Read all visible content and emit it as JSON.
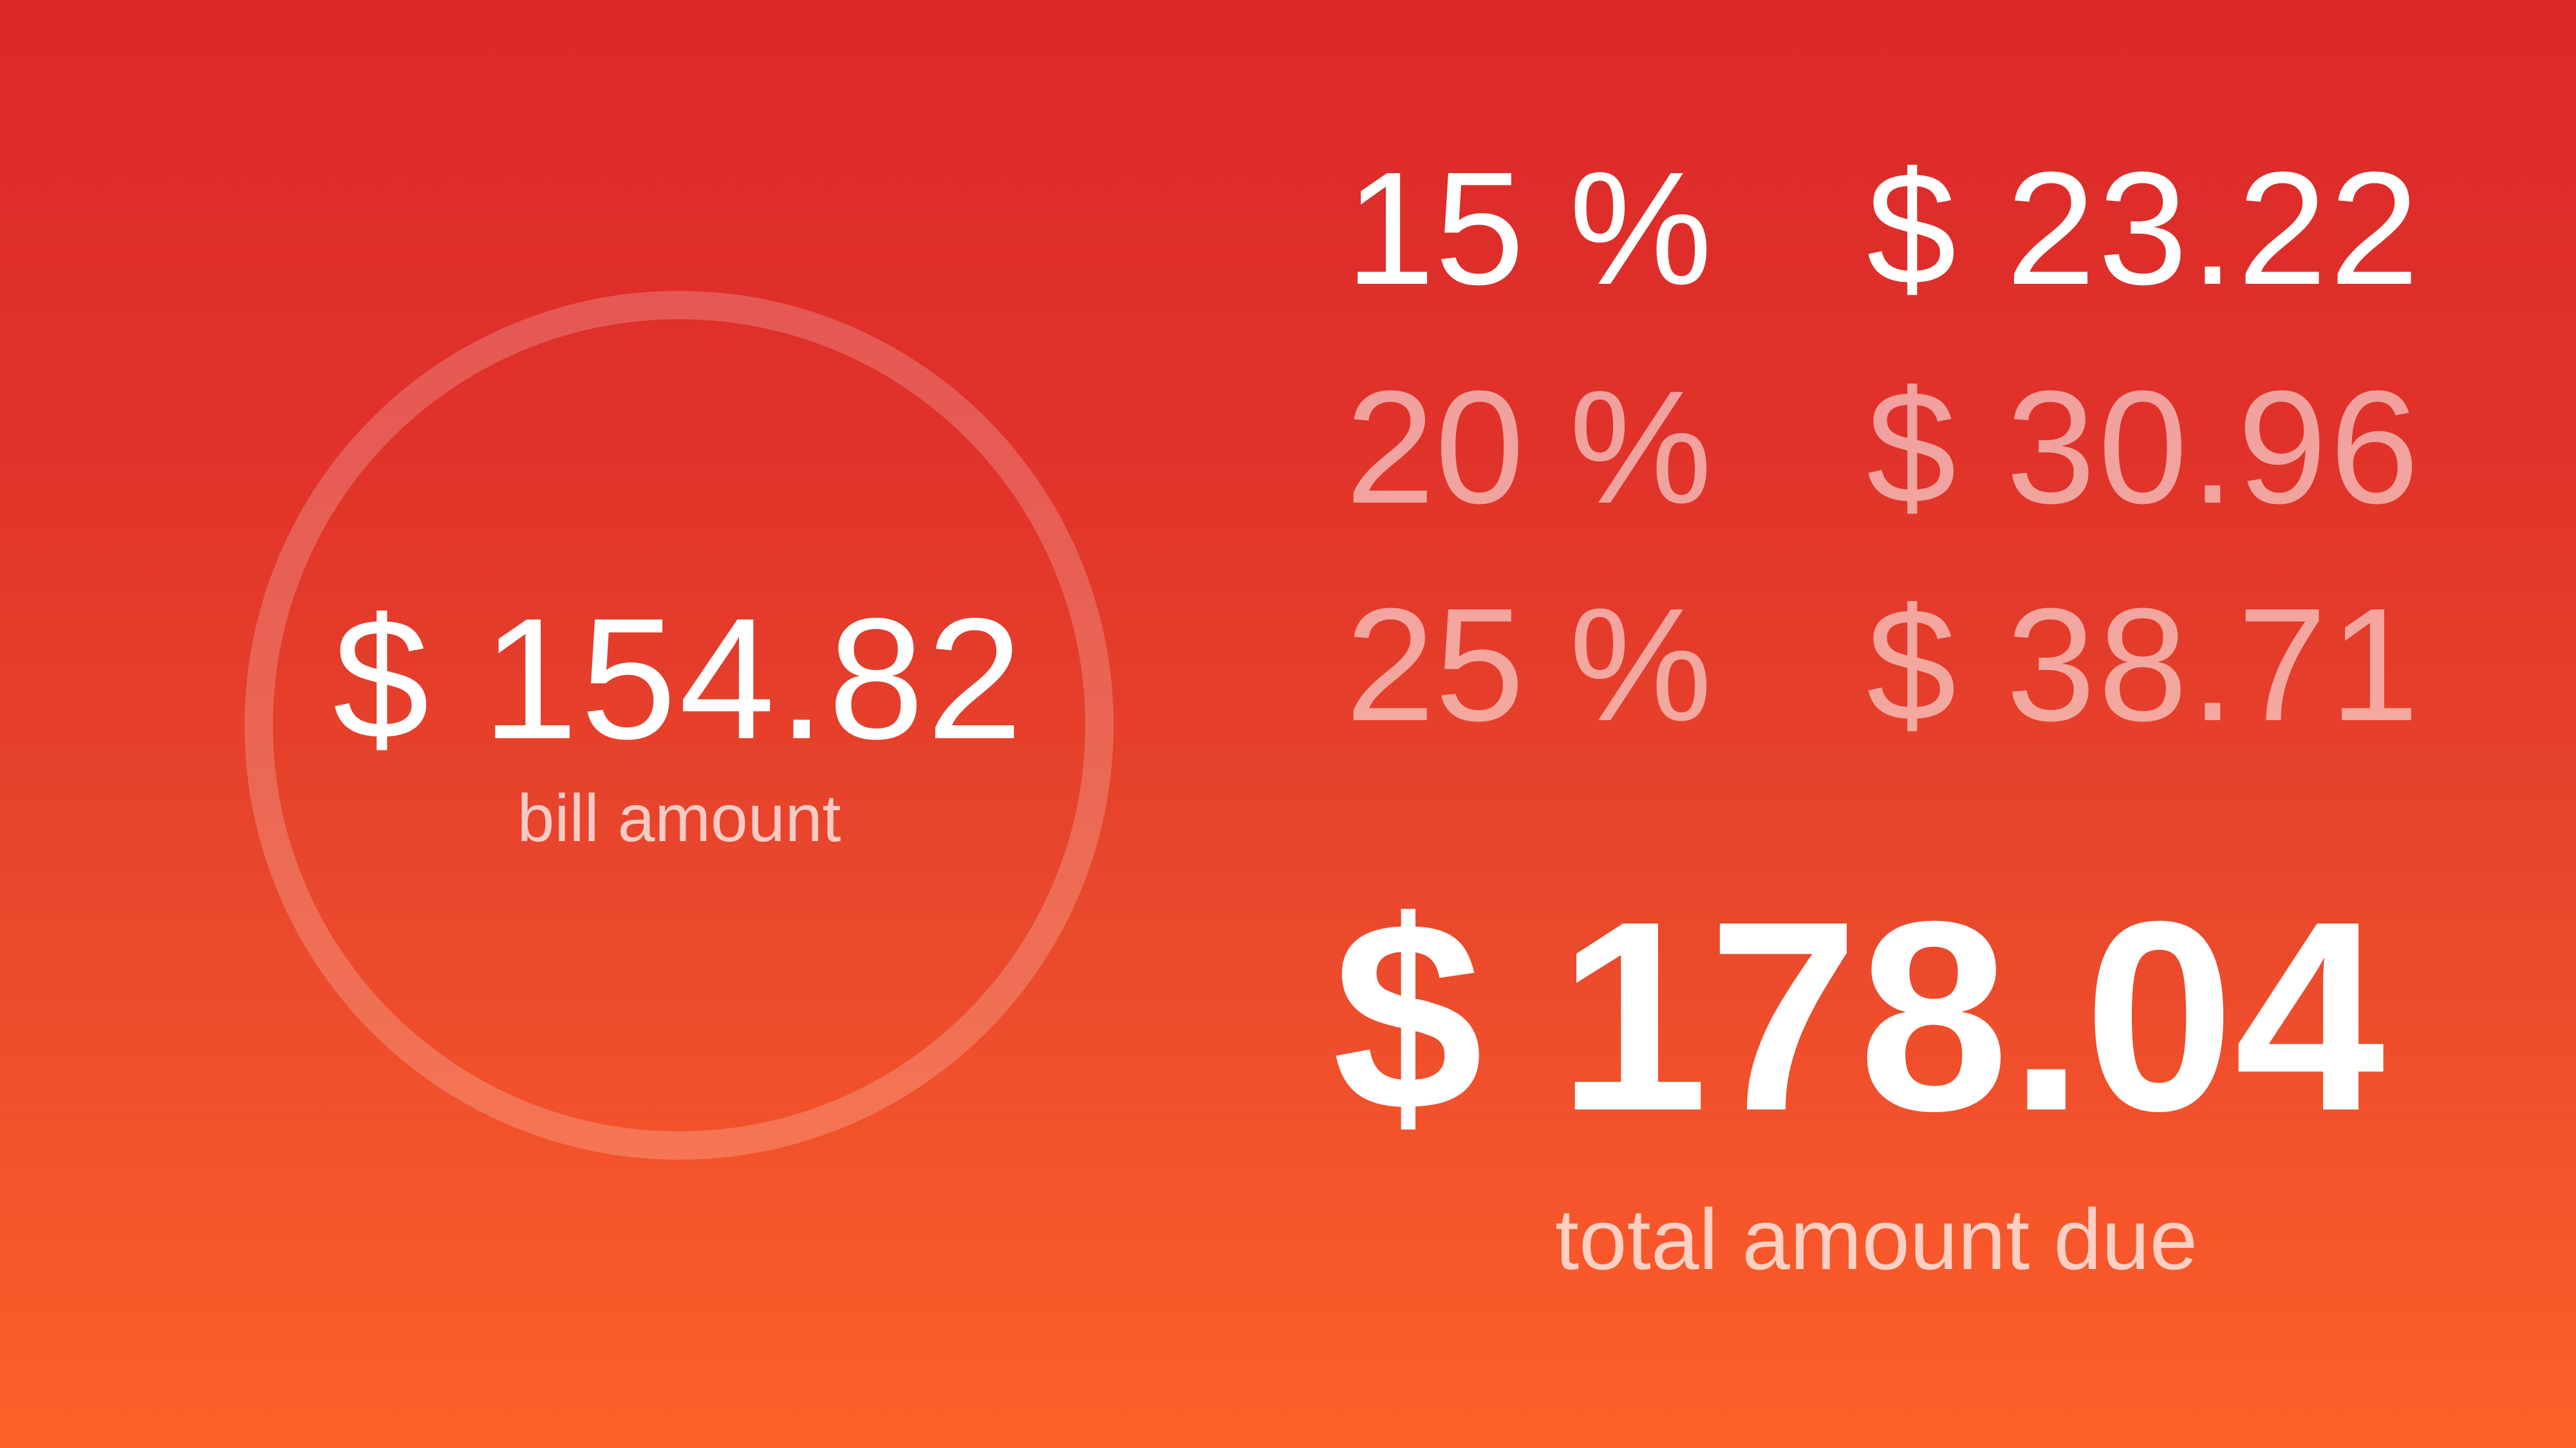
{
  "bill": {
    "amount": "$ 154.82",
    "label": "bill amount"
  },
  "tips": [
    {
      "percent": "15 %",
      "amount": "$ 23.22",
      "selected": true
    },
    {
      "percent": "20 %",
      "amount": "$ 30.96",
      "selected": false
    },
    {
      "percent": "25 %",
      "amount": "$ 38.71",
      "selected": false
    }
  ],
  "total": {
    "amount": "$ 178.04",
    "label": "total amount due"
  },
  "colors": {
    "gradient_top": "#dd2929",
    "gradient_bottom": "#ff5f28",
    "text": "#ffffff"
  }
}
